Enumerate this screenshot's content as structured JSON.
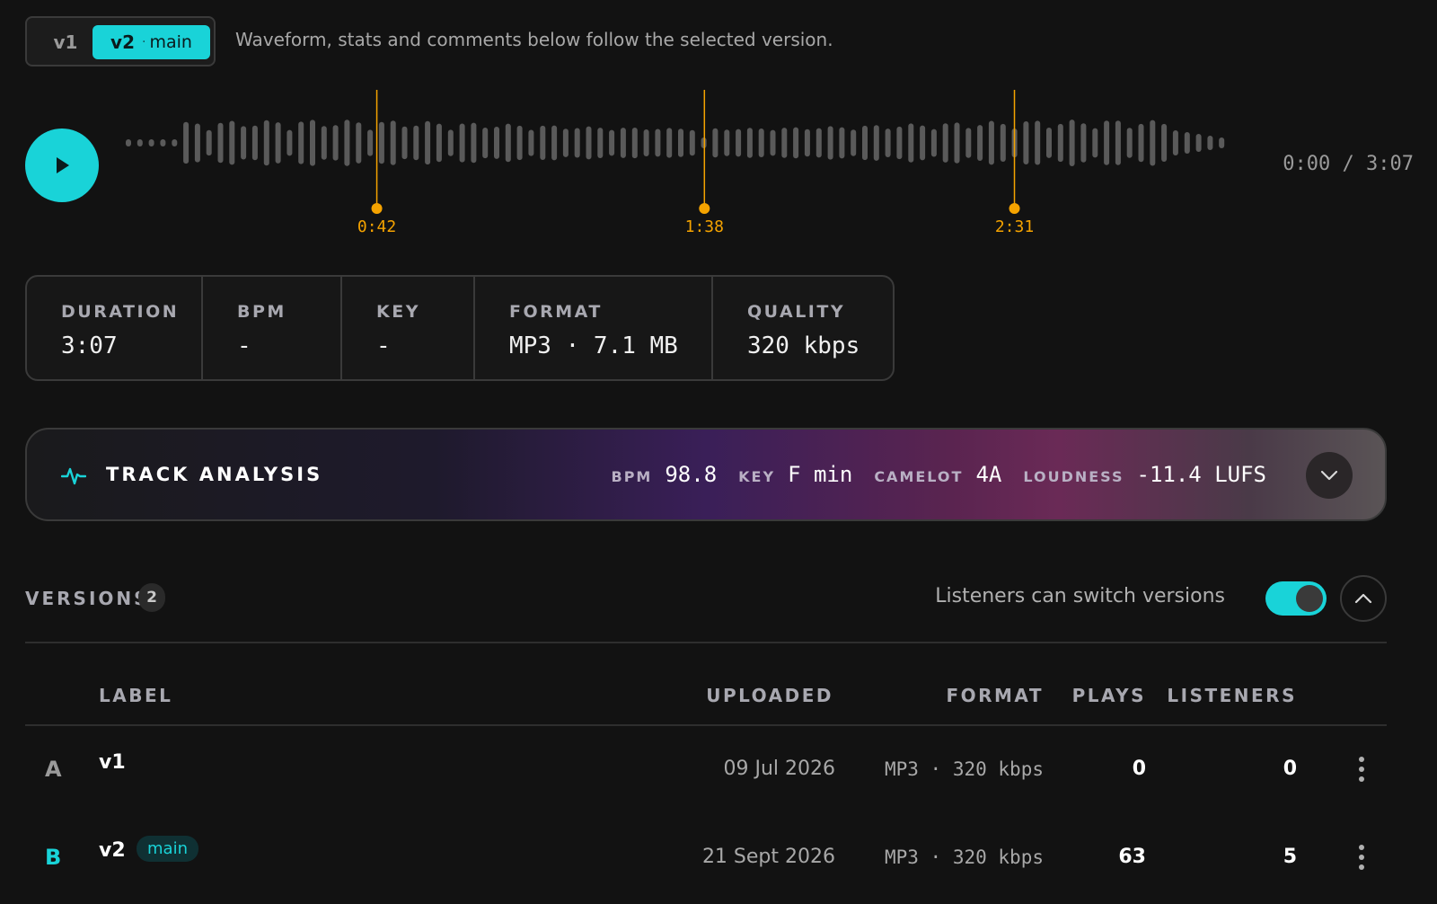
{
  "version_switcher": {
    "tabs": [
      {
        "label": "v1"
      },
      {
        "label": "v2",
        "tag": "main",
        "separator": "·"
      }
    ],
    "hint": "Waveform, stats and comments below follow the selected version."
  },
  "player": {
    "time_readout": "0:00 / 3:07",
    "markers": [
      {
        "label": "0:42",
        "seconds": 42
      },
      {
        "label": "1:38",
        "seconds": 98
      },
      {
        "label": "2:31",
        "seconds": 151
      }
    ],
    "duration_seconds": 187,
    "icons": {
      "play": "play-icon"
    },
    "colors": {
      "accent": "#19d3d8",
      "marker": "#f5a300",
      "wave": "#5a5a5a"
    }
  },
  "stats": [
    {
      "label": "DURATION",
      "value": "3:07"
    },
    {
      "label": "BPM",
      "value": "-"
    },
    {
      "label": "KEY",
      "value": "-"
    },
    {
      "label": "FORMAT",
      "value": "MP3 · 7.1 MB"
    },
    {
      "label": "QUALITY",
      "value": "320 kbps"
    }
  ],
  "analysis": {
    "title": "TRACK ANALYSIS",
    "icon": "pulse-icon",
    "metrics": [
      {
        "key": "BPM",
        "value": "98.8"
      },
      {
        "key": "KEY",
        "value": "F min"
      },
      {
        "key": "CAMELOT",
        "value": "4A"
      },
      {
        "key": "LOUDNESS",
        "value": "-11.4 LUFS"
      }
    ],
    "toggle_icon": "chevron-down-icon"
  },
  "versions": {
    "title": "VERSIONS",
    "count": "2",
    "switch_label": "Listeners can switch versions",
    "switch_on": true,
    "collapse_icon": "chevron-up-icon",
    "columns": {
      "label": "LABEL",
      "uploaded": "UPLOADED",
      "format": "FORMAT",
      "plays": "PLAYS",
      "listeners": "LISTENERS"
    },
    "rows": [
      {
        "letter": "A",
        "label": "v1",
        "badge": "",
        "uploaded": "09 Jul 2026",
        "format": "MP3 · 320 kbps",
        "plays": "0",
        "listeners": "0",
        "letter_color": "#9a9a9a"
      },
      {
        "letter": "B",
        "label": "v2",
        "badge": "main",
        "uploaded": "21 Sept 2026",
        "format": "MP3 · 320 kbps",
        "plays": "63",
        "listeners": "5",
        "letter_color": "#19d3d8"
      }
    ]
  }
}
